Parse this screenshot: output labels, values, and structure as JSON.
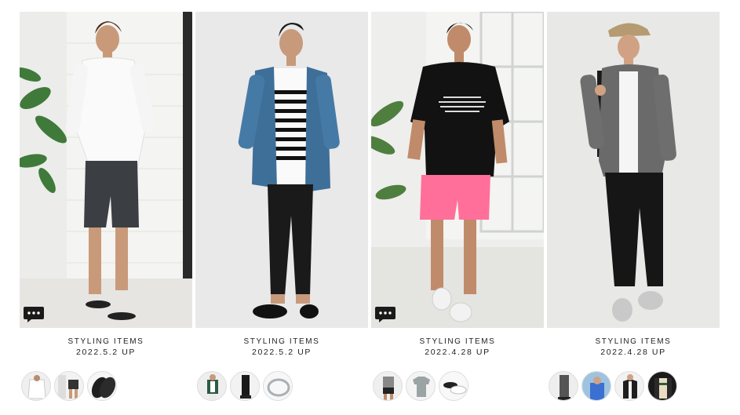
{
  "cards": [
    {
      "label": "STYLING ITEMS",
      "date": "2022.5.2 UP",
      "has_comment_icon": true,
      "thumbs": [
        "white-shirt",
        "shorts-outfit",
        "black-sandals"
      ]
    },
    {
      "label": "STYLING ITEMS",
      "date": "2022.5.2 UP",
      "has_comment_icon": false,
      "thumbs": [
        "cardigan-outfit",
        "black-pants",
        "silver-bangle"
      ]
    },
    {
      "label": "STYLING ITEMS",
      "date": "2022.4.28 UP",
      "has_comment_icon": true,
      "thumbs": [
        "black-shorts-outfit",
        "grey-tshirt",
        "white-sneakers"
      ]
    },
    {
      "label": "STYLING ITEMS",
      "date": "2022.4.28 UP",
      "has_comment_icon": false,
      "thumbs": [
        "grey-pants-outfit",
        "blue-shirt-outfit",
        "black-jacket",
        "striped-jacket"
      ]
    }
  ],
  "colors": {
    "background": "#ffffff",
    "text": "#222222",
    "comment_icon": "#1a1a1a"
  }
}
